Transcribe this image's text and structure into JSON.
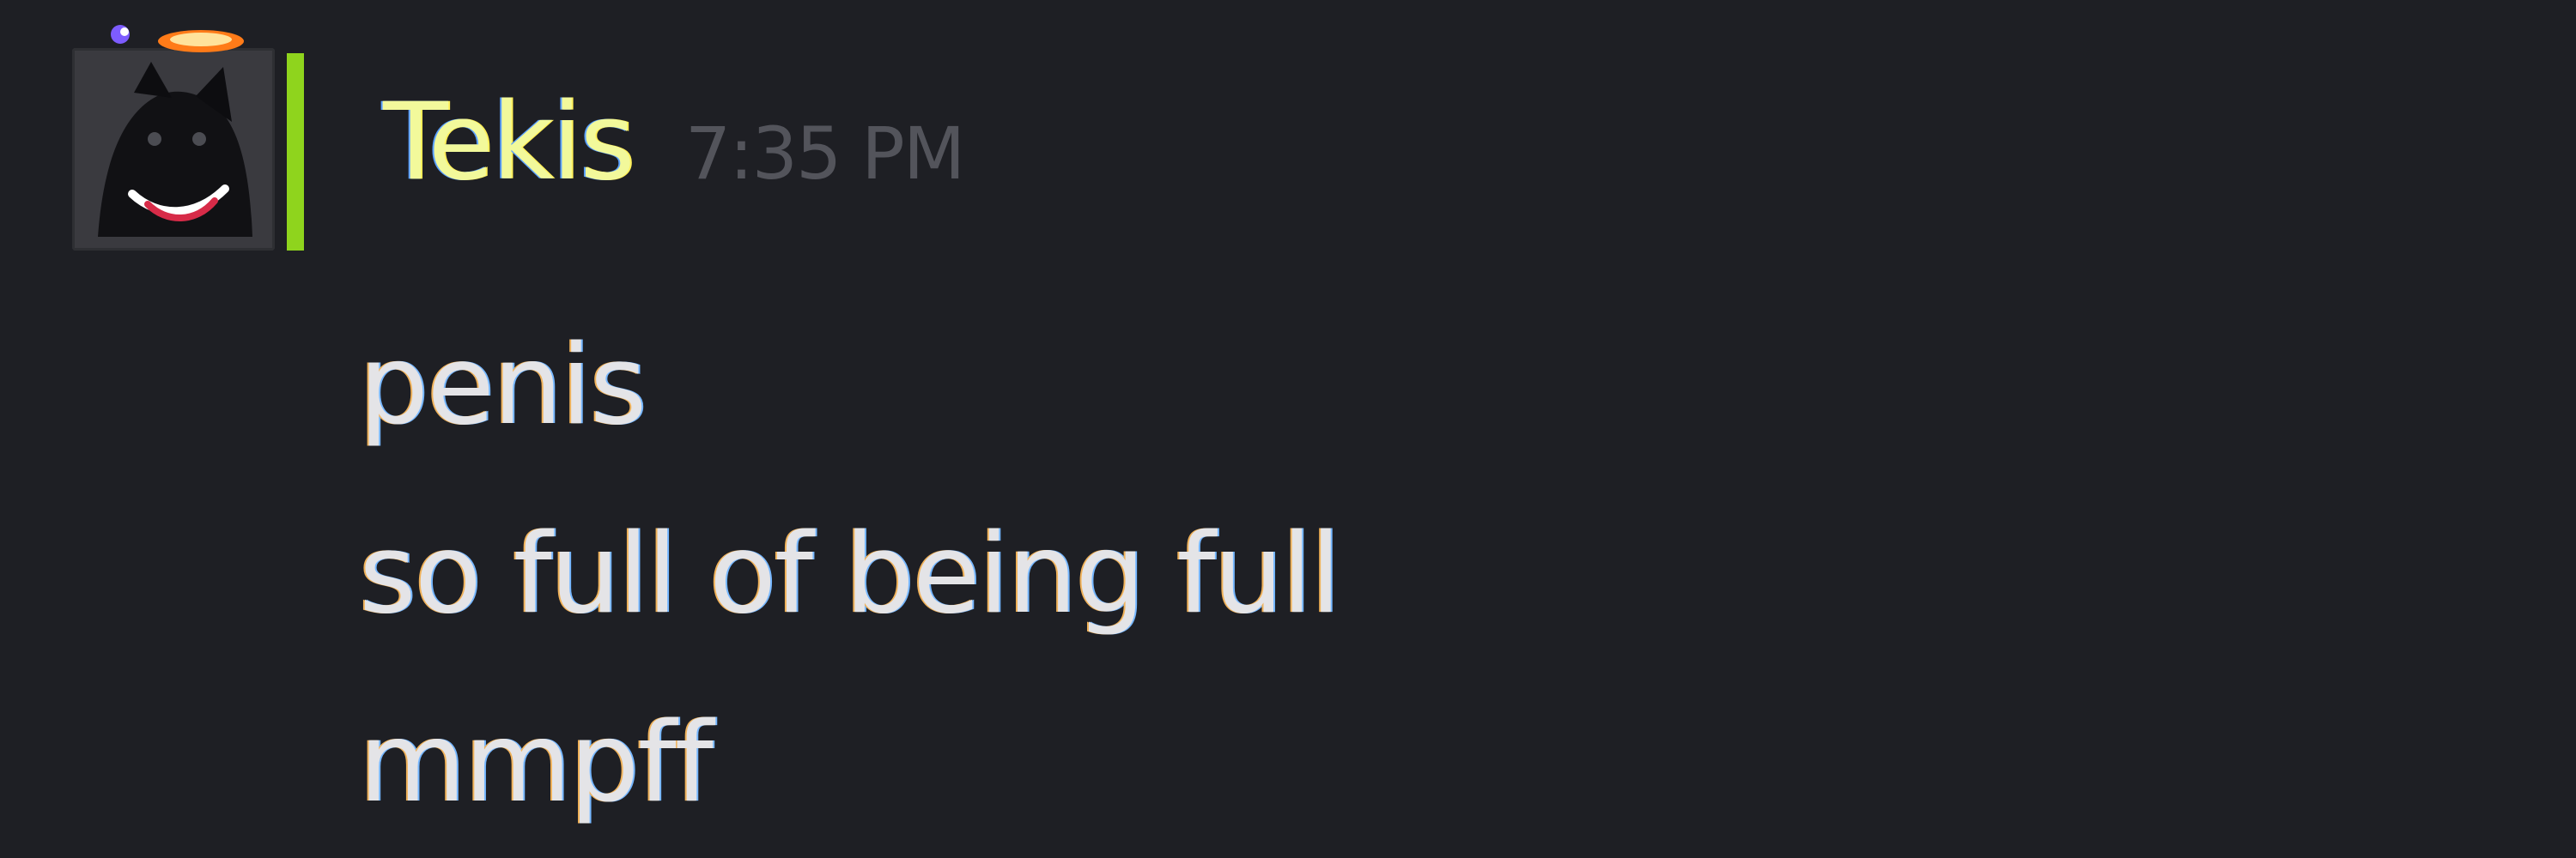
{
  "message": {
    "author": {
      "name": "Tekis",
      "avatar_icon": "dog-avatar-icon",
      "avatar_decoration_icon": "flame-decoration-icon",
      "role_color": "#8fd41d",
      "name_color": "#f2f99b"
    },
    "timestamp": "7:35 PM",
    "lines": [
      {
        "text": "penis"
      },
      {
        "text": "so full of being full"
      },
      {
        "text": "mmpff"
      }
    ]
  },
  "theme": {
    "background": "#1e1f24",
    "text_color": "#e4e4e7",
    "timestamp_color": "#53545b"
  }
}
